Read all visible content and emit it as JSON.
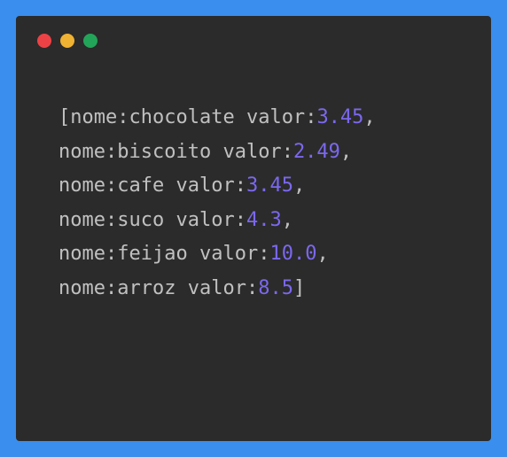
{
  "code": {
    "bracket_open": "[",
    "bracket_close": "]",
    "key_nome": "nome",
    "key_valor": "valor",
    "colon": ":",
    "comma": ",",
    "space": " ",
    "items": [
      {
        "nome": "chocolate",
        "valor": "3.45"
      },
      {
        "nome": "biscoito",
        "valor": "2.49"
      },
      {
        "nome": "cafe",
        "valor": "3.45"
      },
      {
        "nome": "suco",
        "valor": "4.3"
      },
      {
        "nome": "feijao",
        "valor": "10.0"
      },
      {
        "nome": "arroz",
        "valor": "8.5"
      }
    ]
  }
}
